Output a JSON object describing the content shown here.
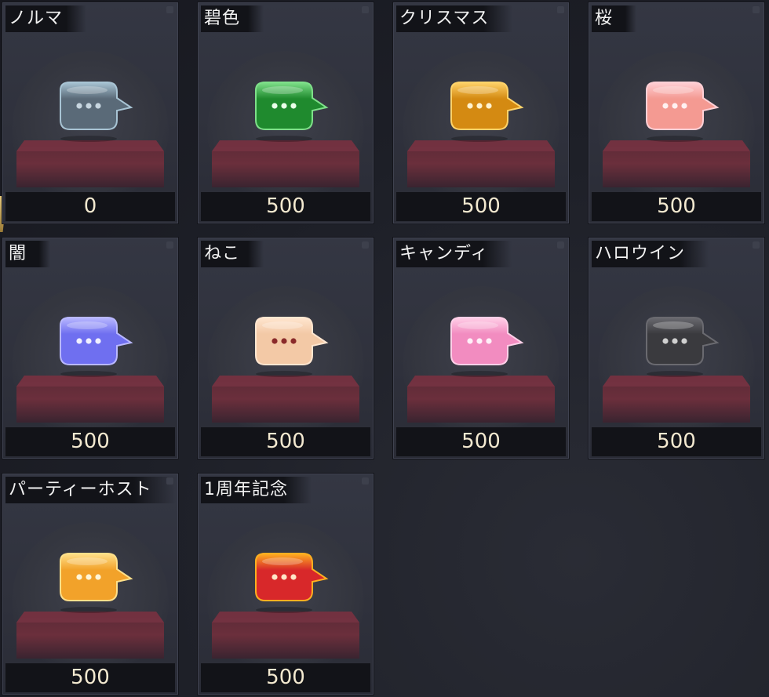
{
  "items": [
    {
      "name": "ノルマ",
      "price": "0",
      "icon": "normal-bubble-icon",
      "color": "#5a6a78",
      "accent": "#a8c4d4",
      "dots": "#c7d6e0"
    },
    {
      "name": "碧色",
      "price": "500",
      "icon": "emerald-bubble-icon",
      "color": "#1f8a2e",
      "accent": "#7fe08a",
      "dots": "#e9ffe9"
    },
    {
      "name": "クリスマス",
      "price": "500",
      "icon": "christmas-bubble-icon",
      "color": "#d48a12",
      "accent": "#ffd36a",
      "dots": "#fff3d0"
    },
    {
      "name": "桜",
      "price": "500",
      "icon": "sakura-bubble-icon",
      "color": "#f49a92",
      "accent": "#ffd0d6",
      "dots": "#fff1f1"
    },
    {
      "name": "闇",
      "price": "500",
      "icon": "darkness-bubble-icon",
      "color": "#6f6ff0",
      "accent": "#b9b8ff",
      "dots": "#f0f0ff"
    },
    {
      "name": "ねこ",
      "price": "500",
      "icon": "cat-bubble-icon",
      "color": "#f3c9a6",
      "accent": "#ffe6d0",
      "dots": "#8a2a2a"
    },
    {
      "name": "キャンディ",
      "price": "500",
      "icon": "candy-bubble-icon",
      "color": "#f28cc0",
      "accent": "#ffd0e8",
      "dots": "#fff0f8"
    },
    {
      "name": "ハロウイン",
      "price": "500",
      "icon": "halloween-bubble-icon",
      "color": "#3a3a3e",
      "accent": "#6a6a70",
      "dots": "#d0d0d0"
    },
    {
      "name": "パーティーホスト",
      "price": "500",
      "icon": "party-host-bubble-icon",
      "color": "#f2a22a",
      "accent": "#ffe08a",
      "dots": "#fff6d8"
    },
    {
      "name": "1周年記念",
      "price": "500",
      "icon": "anniversary-bubble-icon",
      "color": "#d8282a",
      "accent": "#ffb020",
      "dots": "#ffe6c8"
    }
  ]
}
